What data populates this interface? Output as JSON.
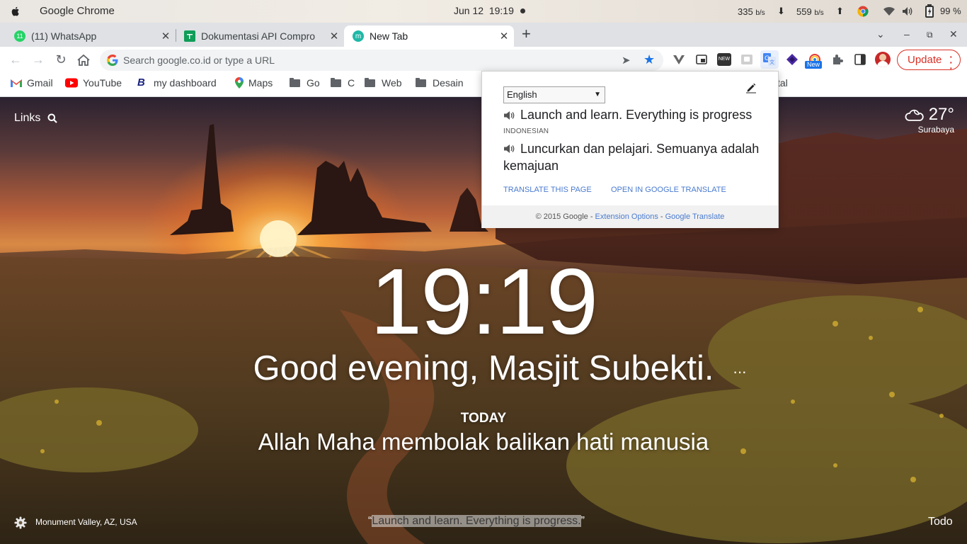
{
  "os_bar": {
    "app_name": "Google Chrome",
    "date": "Jun 12",
    "time": "19:19",
    "net_up": "335",
    "net_down": "559",
    "net_unit": "b/s",
    "battery": "99 %"
  },
  "tabs": [
    {
      "title": "(11) WhatsApp",
      "badge": "11",
      "active": false
    },
    {
      "title": "Dokumentasi API Compro",
      "active": false
    },
    {
      "title": "New Tab",
      "active": true
    }
  ],
  "toolbar": {
    "omnibox_placeholder": "Search google.co.id or type a URL",
    "update_label": "Update",
    "ext_new_badge": "NEW",
    "ext_new_label": "New"
  },
  "bookmarks": [
    {
      "label": "Gmail",
      "icon": "gmail-icon"
    },
    {
      "label": "YouTube",
      "icon": "youtube-icon"
    },
    {
      "label": "my dashboard",
      "icon": "b-icon"
    },
    {
      "label": "Maps",
      "icon": "maps-icon"
    },
    {
      "label": "Go",
      "icon": "folder-icon"
    },
    {
      "label": "C",
      "icon": "folder-icon"
    },
    {
      "label": "Web",
      "icon": "folder-icon"
    },
    {
      "label": "Desain",
      "icon": "folder-icon"
    },
    {
      "label": "tal",
      "icon": "folder-icon"
    }
  ],
  "newtab": {
    "links_label": "Links",
    "weather_temp": "27°",
    "weather_city": "Surabaya",
    "clock": "19:19",
    "greeting": "Good evening, Masjit Subekti.",
    "greeting_more": "···",
    "focus_label": "TODAY",
    "focus_text": "Allah Maha membolak balikan hati manusia",
    "photo_location": "Monument Valley, AZ, USA",
    "quote_open": "“",
    "quote_text": "Launch and learn. Everything is progress.",
    "quote_close": "”",
    "todo_label": "Todo"
  },
  "translate_popup": {
    "source_lang": "English",
    "source_text": "Launch and learn. Everything is progress",
    "target_lang_label": "INDONESIAN",
    "translation": "Luncurkan dan pelajari. Semuanya adalah kemajuan",
    "translate_page": "TRANSLATE THIS PAGE",
    "open_in": "OPEN IN GOOGLE TRANSLATE",
    "footer_copy": "© 2015 Google - ",
    "footer_options": "Extension Options",
    "footer_sep": " - ",
    "footer_gt": "Google Translate"
  },
  "colors": {
    "accent": "#1a73e8",
    "update_red": "#d93025",
    "link_blue": "#4a7bd0",
    "whatsapp_green": "#25d366",
    "sheets_green": "#0f9d58",
    "momentum_teal": "#1fb8a7"
  }
}
